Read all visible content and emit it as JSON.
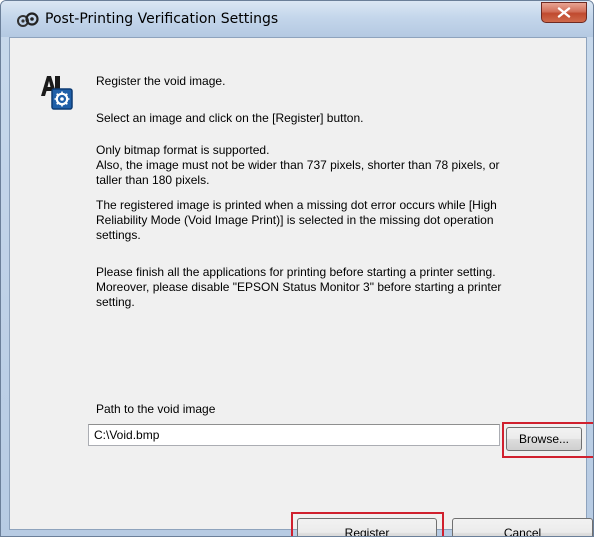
{
  "window": {
    "title": "Post-Printing Verification Settings",
    "close_icon": "close-x-icon",
    "title_icon": "printer-settings-icon"
  },
  "content": {
    "app_icon": "printer-gear-icon",
    "line1": "Register the void image.",
    "line2": "Select an image and click on the [Register] button.",
    "line3": "Only bitmap format is supported.\nAlso, the image must not be wider than 737 pixels, shorter than 78 pixels, or\ntaller than 180 pixels.",
    "line4": "The registered image is printed when a missing dot error occurs while [High\nReliability Mode (Void Image Print)] is selected in the missing dot operation\nsettings.",
    "line5": "Please finish all the applications for printing before starting a printer setting.\nMoreover, please disable \"EPSON Status Monitor 3\" before starting a printer\nsetting."
  },
  "path": {
    "label": "Path to the void image",
    "value": "C:\\Void.bmp"
  },
  "buttons": {
    "browse": "Browse...",
    "register": "Register",
    "cancel": "Cancel"
  },
  "colors": {
    "highlight": "#d0202e",
    "close_button": "#c04a2f",
    "dialog_background": "#f0f0f0"
  }
}
